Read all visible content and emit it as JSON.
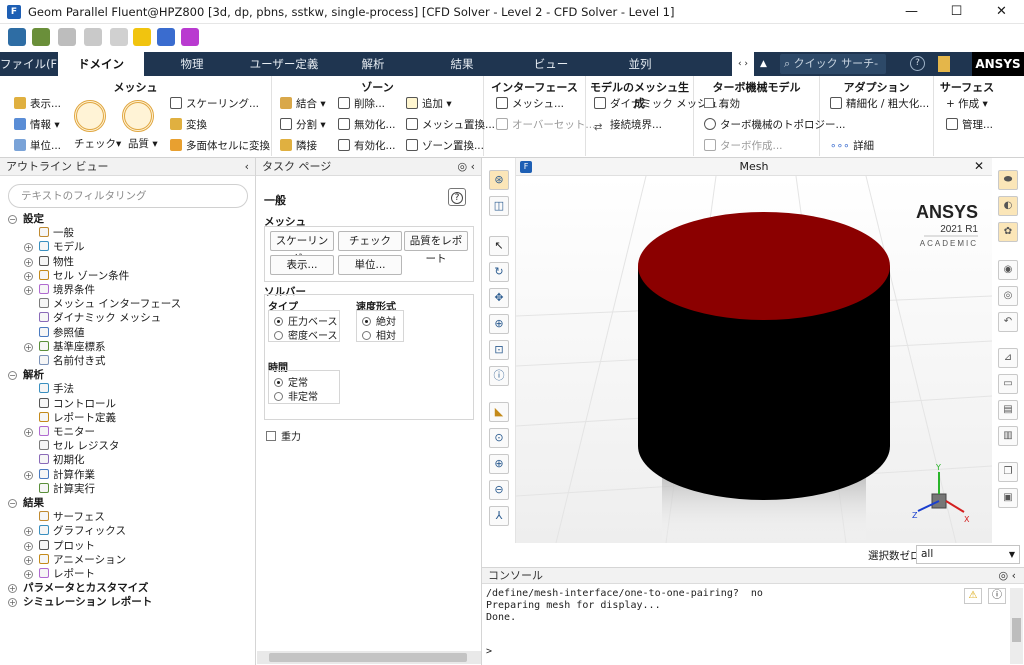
{
  "window": {
    "title": "Geom Parallel Fluent@HPZ800  [3d, dp, pbns, sstkw, single-process] [CFD Solver - Level 2 - CFD Solver - Level 1]",
    "app_icon": "F",
    "minimize": "—",
    "maximize": "☐",
    "close": "✕"
  },
  "tabs": [
    {
      "label": "ファイル(F)"
    },
    {
      "label": "ドメイン"
    },
    {
      "label": "物理"
    },
    {
      "label": "ユーザー定義"
    },
    {
      "label": "解析"
    },
    {
      "label": "結果"
    },
    {
      "label": "ビュー"
    },
    {
      "label": "並列"
    }
  ],
  "search_placeholder": "クイック サーチ-",
  "ansys_brand": "ANSYS",
  "ribbon": {
    "mesh": {
      "title": "メッシュ",
      "display": "表示...",
      "info": "情報",
      "units": "単位...",
      "check": "チェック",
      "quality": "品質",
      "scale": "スケーリング...",
      "transform": "変換",
      "polyhedra": "多面体セルに変換"
    },
    "zones": {
      "title": "ゾーン",
      "combine": "結合",
      "separate": "分割",
      "adjacency": "隣接",
      "delete": "削除...",
      "deactivate": "無効化...",
      "activate": "有効化...",
      "append": "追加",
      "replace_mesh": "メッシュ置換...",
      "replace_zone": "ゾーン置換..."
    },
    "interfaces": {
      "title": "インターフェース",
      "mesh": "メッシュ...",
      "overset": "オーバーセット..."
    },
    "mesh_models": {
      "title": "モデルのメッシュ生成",
      "dynamic_mesh": "ダイナミック メッシュ...",
      "mixing_planes": "接続境界..."
    },
    "turbo": {
      "title": "ターボ機械モデル",
      "enable": "有効",
      "topology": "ターボ機械のトポロジー...",
      "create": "ターボ作成..."
    },
    "adaption": {
      "title": "アダプション",
      "refine": "精細化 / 粗大化...",
      "details": "詳細"
    },
    "surface": {
      "title": "サーフェス",
      "create": "作成",
      "manage": "管理..."
    }
  },
  "outline": {
    "title": "アウトライン ビュー",
    "filter_placeholder": "テキストのフィルタリング",
    "tree": [
      {
        "label": "設定",
        "level": 0,
        "bold": true,
        "expander": "−"
      },
      {
        "label": "一般",
        "level": 1,
        "icon": "general-icon"
      },
      {
        "label": "モデル",
        "level": 1,
        "expander": "+",
        "icon": "models-icon"
      },
      {
        "label": "物性",
        "level": 1,
        "expander": "+",
        "icon": "materials-icon"
      },
      {
        "label": "セル ゾーン条件",
        "level": 1,
        "expander": "+",
        "icon": "cell-zone-icon"
      },
      {
        "label": "境界条件",
        "level": 1,
        "expander": "+",
        "icon": "boundary-icon"
      },
      {
        "label": "メッシュ インターフェース",
        "level": 1,
        "icon": "mesh-interface-icon"
      },
      {
        "label": "ダイナミック メッシュ",
        "level": 1,
        "icon": "dynamic-mesh-icon"
      },
      {
        "label": "参照値",
        "level": 1,
        "icon": "reference-icon"
      },
      {
        "label": "基準座標系",
        "level": 1,
        "expander": "+",
        "icon": "frames-icon"
      },
      {
        "label": "名前付き式",
        "level": 1,
        "icon": "expression-icon"
      },
      {
        "label": "解析",
        "level": 0,
        "bold": true,
        "expander": "−"
      },
      {
        "label": "手法",
        "level": 1,
        "icon": "methods-icon"
      },
      {
        "label": "コントロール",
        "level": 1,
        "icon": "controls-icon"
      },
      {
        "label": "レポート定義",
        "level": 1,
        "icon": "report-def-icon"
      },
      {
        "label": "モニター",
        "level": 1,
        "expander": "+",
        "icon": "monitor-icon"
      },
      {
        "label": "セル レジスタ",
        "level": 1,
        "icon": "register-icon"
      },
      {
        "label": "初期化",
        "level": 1,
        "icon": "init-icon"
      },
      {
        "label": "計算作業",
        "level": 1,
        "expander": "+",
        "icon": "activities-icon"
      },
      {
        "label": "計算実行",
        "level": 1,
        "icon": "run-icon"
      },
      {
        "label": "結果",
        "level": 0,
        "bold": true,
        "expander": "−"
      },
      {
        "label": "サーフェス",
        "level": 1,
        "icon": "surface-icon"
      },
      {
        "label": "グラフィックス",
        "level": 1,
        "expander": "+",
        "icon": "graphics-icon"
      },
      {
        "label": "プロット",
        "level": 1,
        "expander": "+",
        "icon": "plot-icon"
      },
      {
        "label": "アニメーション",
        "level": 1,
        "expander": "+",
        "icon": "animation-icon"
      },
      {
        "label": "レポート",
        "level": 1,
        "expander": "+",
        "icon": "report-icon"
      },
      {
        "label": "パラメータとカスタマイズ",
        "level": 0,
        "bold": true,
        "expander": "+"
      },
      {
        "label": "シミュレーション レポート",
        "level": 0,
        "bold": true,
        "expander": "+"
      }
    ]
  },
  "task": {
    "title": "タスク ページ",
    "heading": "一般",
    "help": "?",
    "mesh_label": "メッシュ",
    "scale": "スケーリング...",
    "check": "チェック",
    "report_quality": "品質をレポート",
    "display": "表示...",
    "units": "単位...",
    "solver_label": "ソルバー",
    "type_label": "タイプ",
    "type_options": [
      "圧力ベース",
      "密度ベース"
    ],
    "velocity_label": "速度形式",
    "velocity_options": [
      "絶対",
      "相対"
    ],
    "time_label": "時間",
    "time_options": [
      "定常",
      "非定常"
    ],
    "gravity": "重力"
  },
  "graphics": {
    "title": "Mesh",
    "close": "✕",
    "brand": "ANSYS",
    "version": "2021 R1",
    "edition": "ACADEMIC",
    "cap_color": "#8b0000",
    "body_color": "#000000"
  },
  "selection": {
    "label": "選択数ゼロ",
    "value": "all"
  },
  "console": {
    "title": "コンソール",
    "lines": [
      "/define/mesh-interface/one-to-one-pairing?  no",
      "Preparing mesh for display...",
      "Done."
    ],
    "prompt": ">"
  }
}
